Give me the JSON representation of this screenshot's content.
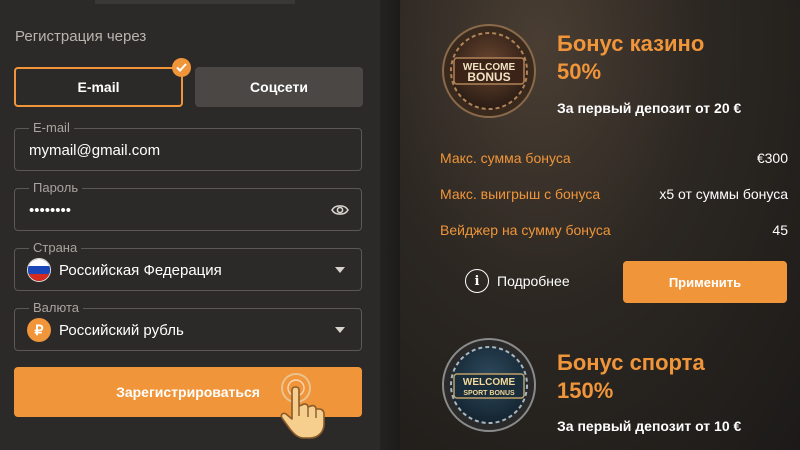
{
  "registration": {
    "title": "Регистрация через",
    "tabs": [
      {
        "label": "E-mail",
        "selected": true
      },
      {
        "label": "Соцсети",
        "selected": false
      }
    ],
    "fields": {
      "email": {
        "label": "E-mail",
        "value": "mymail@gmail.com"
      },
      "password": {
        "label": "Пароль",
        "value": "••••••••"
      },
      "country": {
        "label": "Страна",
        "value": "Российская Федерация"
      },
      "currency": {
        "label": "Валюта",
        "value": "Российский рубль",
        "symbol": "₽"
      }
    },
    "register_label": "Зарегистрироваться"
  },
  "bonuses": {
    "casino": {
      "badge_line1": "WELCOME",
      "badge_line2": "BONUS",
      "title_line1": "Бонус казино",
      "title_line2": "50%",
      "deposit": "За первый депозит от 20 €",
      "rows": [
        {
          "label": "Макс. сумма бонуса",
          "value": "€300"
        },
        {
          "label": "Макс. выигрыш с бонуса",
          "value": "x5 от суммы бонуса"
        },
        {
          "label": "Вейджер на сумму бонуса",
          "value": "45"
        }
      ],
      "more_label": "Подробнее",
      "apply_label": "Применить"
    },
    "sport": {
      "badge_line1": "WELCOME",
      "badge_line2": "SPORT BONUS",
      "title_line1": "Бонус спорта",
      "title_line2": "150%",
      "deposit": "За первый депозит от 10 €"
    }
  },
  "colors": {
    "accent": "#f0953a",
    "panel": "#2c2a29",
    "secondary_button": "#4a4745"
  }
}
